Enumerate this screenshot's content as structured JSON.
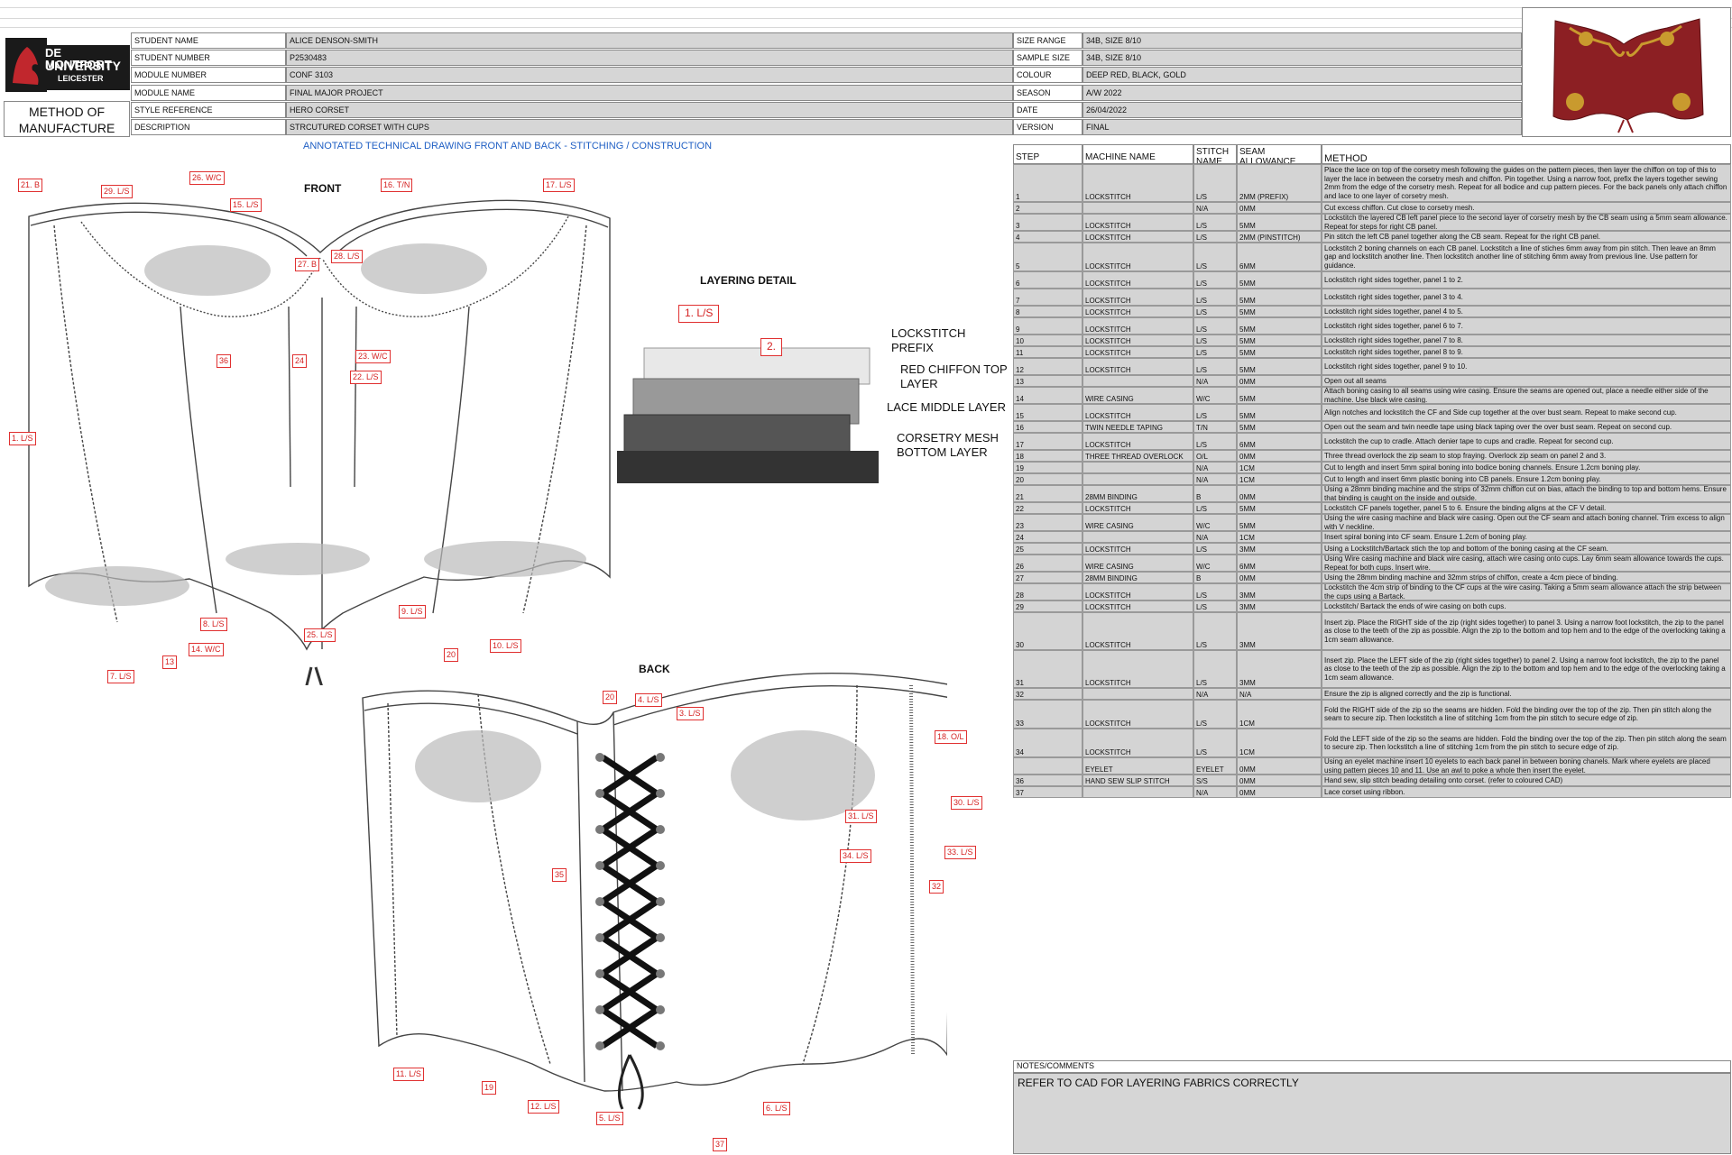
{
  "header": {
    "logo": {
      "line1": "DE MONTFORT",
      "line2": "UNIVERSITY",
      "line3": "LEICESTER"
    },
    "method_title": "METHOD OF MANUFACTURE",
    "left_fields": [
      {
        "label": "STUDENT NAME",
        "value": "ALICE DENSON-SMITH"
      },
      {
        "label": "STUDENT NUMBER",
        "value": "P2530483"
      },
      {
        "label": "MODULE NUMBER",
        "value": "CONF 3103"
      },
      {
        "label": "MODULE NAME",
        "value": "FINAL MAJOR PROJECT"
      },
      {
        "label": "STYLE REFERENCE",
        "value": "HERO CORSET"
      },
      {
        "label": "DESCRIPTION",
        "value": "STRCUTURED CORSET WITH CUPS"
      }
    ],
    "right_fields": [
      {
        "label": "SIZE RANGE",
        "value": "34B, SIZE 8/10"
      },
      {
        "label": "SAMPLE SIZE",
        "value": "34B, SIZE 8/10"
      },
      {
        "label": "COLOUR",
        "value": "DEEP RED, BLACK, GOLD"
      },
      {
        "label": "SEASON",
        "value": "A/W 2022"
      },
      {
        "label": "DATE",
        "value": "26/04/2022"
      },
      {
        "label": "VERSION",
        "value": "FINAL"
      }
    ]
  },
  "drawing": {
    "title": "ANNOTATED TECHNICAL DRAWING FRONT AND BACK - STITCHING / CONSTRUCTION",
    "front_label": "FRONT",
    "back_label": "BACK",
    "layering_title": "LAYERING DETAIL",
    "layering_labels": [
      "LOCKSTITCH PREFIX",
      "RED CHIFFON TOP LAYER",
      "LACE MIDDLE LAYER",
      "CORSETRY MESH BOTTOM LAYER"
    ],
    "layering_callouts": [
      "1. L/S",
      "2."
    ],
    "front_callouts": [
      "21. B",
      "29. L/S",
      "26. W/C",
      "15. L/S",
      "16. T/N",
      "17. L/S",
      "27. B",
      "28. L/S",
      "36",
      "24",
      "23. W/C",
      "22. L/S",
      "1. L/S",
      "8. L/S",
      "9. L/S",
      "25. L/S",
      "10. L/S",
      "20",
      "14. W/C",
      "13",
      "7. L/S"
    ],
    "back_callouts": [
      "20",
      "4. L/S",
      "3. L/S",
      "18. O/L",
      "30. L/S",
      "31. L/S",
      "34. L/S",
      "33. L/S",
      "35",
      "32",
      "11. L/S",
      "19",
      "12. L/S",
      "5. L/S",
      "6. L/S",
      "37"
    ]
  },
  "table": {
    "headers": {
      "step": "STEP NUMBER",
      "machine": "MACHINE NAME",
      "stitch": "STITCH NAME",
      "seam": "SEAM ALLOWANCE",
      "method": "METHOD"
    },
    "rows": [
      {
        "n": "1",
        "machine": "LOCKSTITCH",
        "stitch": "L/S",
        "seam": "2MM (PREFIX)",
        "method": "Place the lace on top of the corsetry mesh following the guides on the pattern pieces, then layer the chiffon on top of this to layer the lace in between the corsetry mesh and chiffon. Pin together. Using a narrow foot, prefix the layers together sewing 2mm from the edge of the corsetry mesh. Repeat for all bodice and cup pattern pieces. For the back panels only attach chiffon and lace to one layer of corsetry mesh."
      },
      {
        "n": "2",
        "machine": "",
        "stitch": "N/A",
        "seam": "0MM",
        "method": "Cut excess chiffon. Cut close to corsetry mesh."
      },
      {
        "n": "3",
        "machine": "LOCKSTITCH",
        "stitch": "L/S",
        "seam": "5MM",
        "method": "Lockstitch the layered CB left panel piece to the second layer of corsetry mesh by the CB seam using a 5mm seam allowance. Repeat for steps for right CB panel."
      },
      {
        "n": "4",
        "machine": "LOCKSTITCH",
        "stitch": "L/S",
        "seam": "2MM (PINSTITCH)",
        "method": "Pin stitch the left CB panel together along the CB seam. Repeat for the right CB panel."
      },
      {
        "n": "5",
        "machine": "LOCKSTITCH",
        "stitch": "L/S",
        "seam": "6MM",
        "method": "Lockstitch 2 boning channels on each CB panel. Lockstitch a line of stiches 6mm away from pin stitch. Then leave an 8mm gap and lockstitch another line. Then lockstitch another line of stitching 6mm away from previous line. Use pattern for guidance."
      },
      {
        "n": "6",
        "machine": "LOCKSTITCH",
        "stitch": "L/S",
        "seam": "5MM",
        "method": "Lockstitch right sides together, panel 1 to 2."
      },
      {
        "n": "7",
        "machine": "LOCKSTITCH",
        "stitch": "L/S",
        "seam": "5MM",
        "method": "Lockstitch right sides together, panel 3 to 4."
      },
      {
        "n": "8",
        "machine": "LOCKSTITCH",
        "stitch": "L/S",
        "seam": "5MM",
        "method": "Lockstitch right sides together, panel 4 to 5."
      },
      {
        "n": "9",
        "machine": "LOCKSTITCH",
        "stitch": "L/S",
        "seam": "5MM",
        "method": "Lockstitch right sides together, panel 6 to 7."
      },
      {
        "n": "10",
        "machine": "LOCKSTITCH",
        "stitch": "L/S",
        "seam": "5MM",
        "method": "Lockstitch right sides together, panel 7 to 8."
      },
      {
        "n": "11",
        "machine": "LOCKSTITCH",
        "stitch": "L/S",
        "seam": "5MM",
        "method": "Lockstitch right sides together, panel 8 to 9."
      },
      {
        "n": "12",
        "machine": "LOCKSTITCH",
        "stitch": "L/S",
        "seam": "5MM",
        "method": "Lockstitch right sides together, panel 9 to 10."
      },
      {
        "n": "13",
        "machine": "",
        "stitch": "N/A",
        "seam": "0MM",
        "method": "Open out all seams"
      },
      {
        "n": "14",
        "machine": "WIRE CASING",
        "stitch": "W/C",
        "seam": "5MM",
        "method": "Attach boning casing to all seams using wire casing. Ensure the seams are opened out, place a needle either side of the machine. Use black wire casing."
      },
      {
        "n": "15",
        "machine": "LOCKSTITCH",
        "stitch": "L/S",
        "seam": "5MM",
        "method": "Align notches and lockstitch the CF and Side cup together at the over bust seam. Repeat to make second cup."
      },
      {
        "n": "16",
        "machine": "TWIN NEEDLE TAPING",
        "stitch": "T/N",
        "seam": "5MM",
        "method": "Open out the seam and twin needle tape using black taping over the over bust seam. Repeat on second cup."
      },
      {
        "n": "17",
        "machine": "LOCKSTITCH",
        "stitch": "L/S",
        "seam": "6MM",
        "method": "Lockstitch the cup to cradle. Attach denier tape to cups and cradle. Repeat for second cup."
      },
      {
        "n": "18",
        "machine": "THREE THREAD OVERLOCK",
        "stitch": "O/L",
        "seam": "0MM",
        "method": "Three thread overlock the zip seam to stop fraying. Overlock zip seam on panel 2 and 3."
      },
      {
        "n": "19",
        "machine": "",
        "stitch": "N/A",
        "seam": "1CM",
        "method": "Cut to length and insert 5mm spiral boning into bodice boning channels. Ensure 1.2cm boning play."
      },
      {
        "n": "20",
        "machine": "",
        "stitch": "N/A",
        "seam": "1CM",
        "method": "Cut to length and insert 6mm plastic boning into CB panels. Ensure 1.2cm boning play."
      },
      {
        "n": "21",
        "machine": "28MM BINDING",
        "stitch": "B",
        "seam": "0MM",
        "method": "Using a 28mm binding machine and the strips of 32mm chiffon cut on bias, attach the binding to top and bottom hems. Ensure that binding is caught on the inside and outside."
      },
      {
        "n": "22",
        "machine": "LOCKSTITCH",
        "stitch": "L/S",
        "seam": "5MM",
        "method": "Lockstitch CF panels together, panel 5 to 6. Ensure the binding aligns at the CF V detail."
      },
      {
        "n": "23",
        "machine": "WIRE CASING",
        "stitch": "W/C",
        "seam": "5MM",
        "method": "Using the wire casing machine and black wire casing. Open out the CF seam and attach boning channel. Trim excess to align with V neckline."
      },
      {
        "n": "24",
        "machine": "",
        "stitch": "N/A",
        "seam": "1CM",
        "method": "Insert spiral boning into CF seam. Ensure 1.2cm of boning play."
      },
      {
        "n": "25",
        "machine": "LOCKSTITCH",
        "stitch": "L/S",
        "seam": "3MM",
        "method": "Using a Lockstitch/Bartack stich the top and bottom of the boning casing at the CF seam."
      },
      {
        "n": "26",
        "machine": "WIRE CASING",
        "stitch": "W/C",
        "seam": "6MM",
        "method": "Using Wire casing machine and black wire casing, attach wire casing onto cups. Lay 6mm seam allowance towards the cups. Repeat for both cups. Insert wire."
      },
      {
        "n": "27",
        "machine": "28MM BINDING",
        "stitch": "B",
        "seam": "0MM",
        "method": "Using the 28mm binding machine and 32mm strips of chiffon, create a 4cm piece of binding."
      },
      {
        "n": "28",
        "machine": "LOCKSTITCH",
        "stitch": "L/S",
        "seam": "3MM",
        "method": "Lockstitch the 4cm strip of binding to the CF cups at the wire casing. Taking a 5mm seam allowance attach the strip between the cups using a Bartack."
      },
      {
        "n": "29",
        "machine": "LOCKSTITCH",
        "stitch": "L/S",
        "seam": "3MM",
        "method": "Lockstitch/ Bartack the ends of wire casing on both cups."
      },
      {
        "n": "30",
        "machine": "LOCKSTITCH",
        "stitch": "L/S",
        "seam": "3MM",
        "method": "Insert zip. Place the RIGHT side of the zip (right sides together) to panel 3. Using a narrow foot lockstitch, the zip to the panel as close to the teeth of the zip as possible. Align the zip to the bottom and top hem and to the edge of the overlocking taking a 1cm seam allowance."
      },
      {
        "n": "31",
        "machine": "LOCKSTITCH",
        "stitch": "L/S",
        "seam": "3MM",
        "method": "Insert zip. Place the LEFT side of the zip (right sides together) to panel 2. Using a narrow foot lockstitch, the zip to the panel as close to the teeth of the zip as possible. Align the zip to the bottom and top hem and to the edge of the overlocking taking a 1cm seam allowance."
      },
      {
        "n": "32",
        "machine": "",
        "stitch": "N/A",
        "seam": "N/A",
        "method": "Ensure the zip is aligned correctly and the zip is functional."
      },
      {
        "n": "33",
        "machine": "LOCKSTITCH",
        "stitch": "L/S",
        "seam": "1CM",
        "method": "Fold the RIGHT side of the zip so the seams are hidden. Fold the binding over the top of the zip. Then pin stitch along the seam to secure zip. Then lockstitch a line of stitching 1cm from the pin stitch to secure edge of zip."
      },
      {
        "n": "34",
        "machine": "LOCKSTITCH",
        "stitch": "L/S",
        "seam": "1CM",
        "method": "Fold the LEFT side of the zip so the seams are hidden. Fold the binding over the top of the zip. Then pin stitch along the seam to secure zip. Then lockstitch a line of stitching 1cm from the pin stitch to secure edge of zip."
      },
      {
        "n": "",
        "machine": "EYELET",
        "stitch": "EYELET",
        "seam": "0MM",
        "method": "Using an eyelet machine insert 10 eyelets to each back panel in between boning chanels. Mark where eyelets are placed using pattern pieces 10 and 11. Use an awl to poke a whole then insert the eyelet."
      },
      {
        "n": "36",
        "machine": "HAND SEW SLIP STITCH",
        "stitch": "S/S",
        "seam": "0MM",
        "method": "Hand sew, slip stitch beading detailing onto corset. (refer to coloured CAD)"
      },
      {
        "n": "37",
        "machine": "",
        "stitch": "N/A",
        "seam": "0MM",
        "method": "Lace corset using ribbon."
      }
    ]
  },
  "notes": {
    "label": "NOTES/COMMENTS",
    "value": "REFER TO CAD FOR LAYERING FABRICS CORRECTLY"
  },
  "colors": {
    "callout": "#e03030",
    "cell_grey": "#d4d4d4",
    "title_blue": "#1f5fc4",
    "corset_red": "#8c1f23",
    "gold": "#c99a2e"
  }
}
